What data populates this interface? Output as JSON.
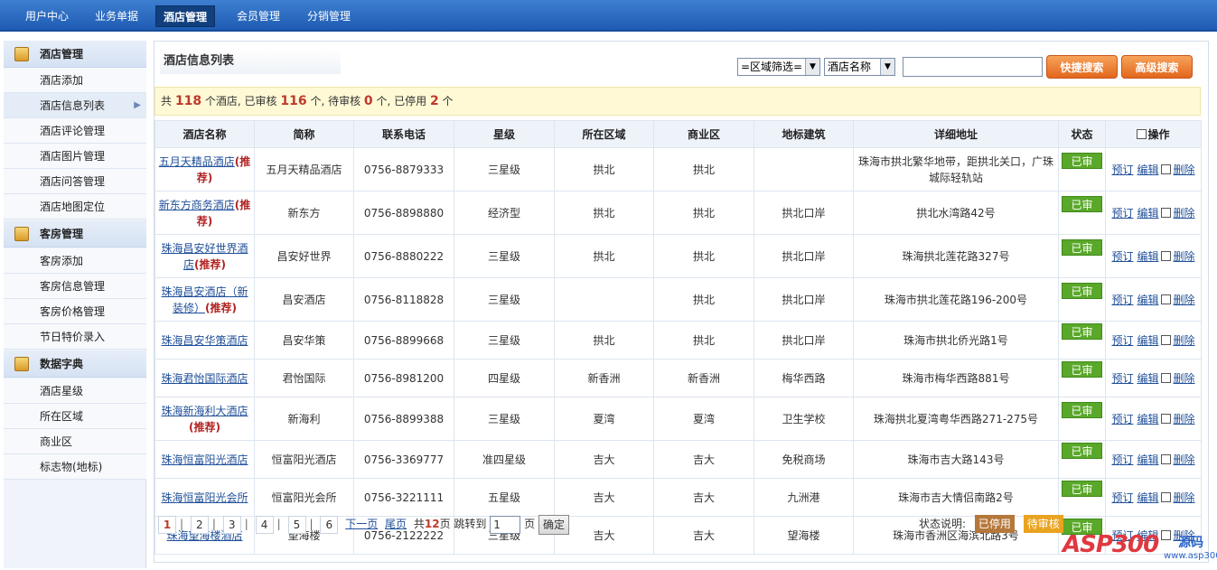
{
  "topnav": {
    "items": [
      "用户中心",
      "业务单据",
      "酒店管理",
      "会员管理",
      "分销管理"
    ],
    "active_index": 2
  },
  "sidebar": {
    "groups": [
      {
        "title": "酒店管理",
        "icon": "folder-icon",
        "items": [
          "酒店添加",
          "酒店信息列表",
          "酒店评论管理",
          "酒店图片管理",
          "酒店问答管理",
          "酒店地图定位"
        ]
      },
      {
        "title": "客房管理",
        "icon": "folder-icon",
        "items": [
          "客房添加",
          "客房信息管理",
          "客房价格管理",
          "节日特价录入"
        ]
      },
      {
        "title": "数据字典",
        "icon": "folder-icon",
        "items": [
          "酒店星级",
          "所在区域",
          "商业区",
          "标志物(地标)"
        ]
      }
    ],
    "active_item": "酒店信息列表"
  },
  "main": {
    "title": "酒店信息列表",
    "region_select": "=区域筛选=",
    "field_select": "酒店名称",
    "search_value": "",
    "quick_search": "快捷搜索",
    "advanced_search": "高级搜索"
  },
  "summary": {
    "prefix": "共",
    "total": "118",
    "t1": "个酒店, 已审核",
    "approved": "116",
    "t2": "个, 待审核",
    "pending": "0",
    "t3": "个, 已停用",
    "disabled": "2",
    "t4": "个"
  },
  "table": {
    "headers": [
      "酒店名称",
      "简称",
      "联系电话",
      "星级",
      "所在区域",
      "商业区",
      "地标建筑",
      "详细地址",
      "状态",
      "操作"
    ],
    "recommend_label": "(推荐)",
    "status_label": "已审核",
    "op_labels": {
      "book": "预订",
      "edit": "编辑",
      "delete": "删除"
    },
    "rows": [
      {
        "name": "五月天精品酒店",
        "rec": true,
        "short": "五月天精品酒店",
        "phone": "0756-8879333",
        "star": "三星级",
        "area": "拱北",
        "biz": "拱北",
        "landmark": "",
        "address": "珠海市拱北繁华地带，距拱北关口，广珠城际轻轨站"
      },
      {
        "name": "新东方商务酒店",
        "rec": true,
        "short": "新东方",
        "phone": "0756-8898880",
        "star": "经济型",
        "area": "拱北",
        "biz": "拱北",
        "landmark": "拱北口岸",
        "address": "拱北水湾路42号"
      },
      {
        "name": "珠海昌安好世界酒店",
        "rec": true,
        "short": "昌安好世界",
        "phone": "0756-8880222",
        "star": "三星级",
        "area": "拱北",
        "biz": "拱北",
        "landmark": "拱北口岸",
        "address": "珠海拱北莲花路327号"
      },
      {
        "name": "珠海昌安酒店（新装修）",
        "rec": true,
        "short": "昌安酒店",
        "phone": "0756-8118828",
        "star": "三星级",
        "area": "",
        "biz": "拱北",
        "landmark": "拱北口岸",
        "address": "珠海市拱北莲花路196-200号"
      },
      {
        "name": "珠海昌安华策酒店",
        "rec": false,
        "short": "昌安华策",
        "phone": "0756-8899668",
        "star": "三星级",
        "area": "拱北",
        "biz": "拱北",
        "landmark": "拱北口岸",
        "address": "珠海市拱北侨光路1号"
      },
      {
        "name": "珠海君怡国际酒店",
        "rec": false,
        "short": "君怡国际",
        "phone": "0756-8981200",
        "star": "四星级",
        "area": "新香洲",
        "biz": "新香洲",
        "landmark": "梅华西路",
        "address": "珠海市梅华西路881号"
      },
      {
        "name": "珠海新海利大酒店",
        "rec": true,
        "short": "新海利",
        "phone": "0756-8899388",
        "star": "三星级",
        "area": "夏湾",
        "biz": "夏湾",
        "landmark": "卫生学校",
        "address": "珠海拱北夏湾粤华西路271-275号"
      },
      {
        "name": "珠海恒富阳光酒店",
        "rec": false,
        "short": "恒富阳光酒店",
        "phone": "0756-3369777",
        "star": "准四星级",
        "area": "吉大",
        "biz": "吉大",
        "landmark": "免税商场",
        "address": "珠海市吉大路143号"
      },
      {
        "name": "珠海恒富阳光会所",
        "rec": false,
        "short": "恒富阳光会所",
        "phone": "0756-3221111",
        "star": "五星级",
        "area": "吉大",
        "biz": "吉大",
        "landmark": "九洲港",
        "address": "珠海市吉大情侣南路2号"
      },
      {
        "name": "珠海望海楼酒店",
        "rec": false,
        "short": "望海楼",
        "phone": "0756-2122222",
        "star": "三星级",
        "area": "吉大",
        "biz": "吉大",
        "landmark": "望海楼",
        "address": "珠海市香洲区海滨北路3号"
      }
    ]
  },
  "pager": {
    "pages": [
      "1",
      "2",
      "3",
      "4",
      "5",
      "6"
    ],
    "current": "1",
    "next": "下一页",
    "last": "尾页",
    "total_prefix": "共",
    "total_pages": "12",
    "total_suffix": "页 跳转到",
    "jump_value": "1",
    "page_unit": "页",
    "confirm": "确定"
  },
  "legend": {
    "label": "状态说明:",
    "items": [
      {
        "text": "已停用",
        "color": "#b5773a"
      },
      {
        "text": "待审核",
        "color": "#e9a321"
      }
    ]
  },
  "watermark": {
    "logo": "ASP300",
    "sub": "源码",
    "url": "www.asp300.com"
  },
  "colors": {
    "nav": "#2a6ac4",
    "accent_orange": "#e2661c",
    "approved_green": "#5aa82a"
  }
}
